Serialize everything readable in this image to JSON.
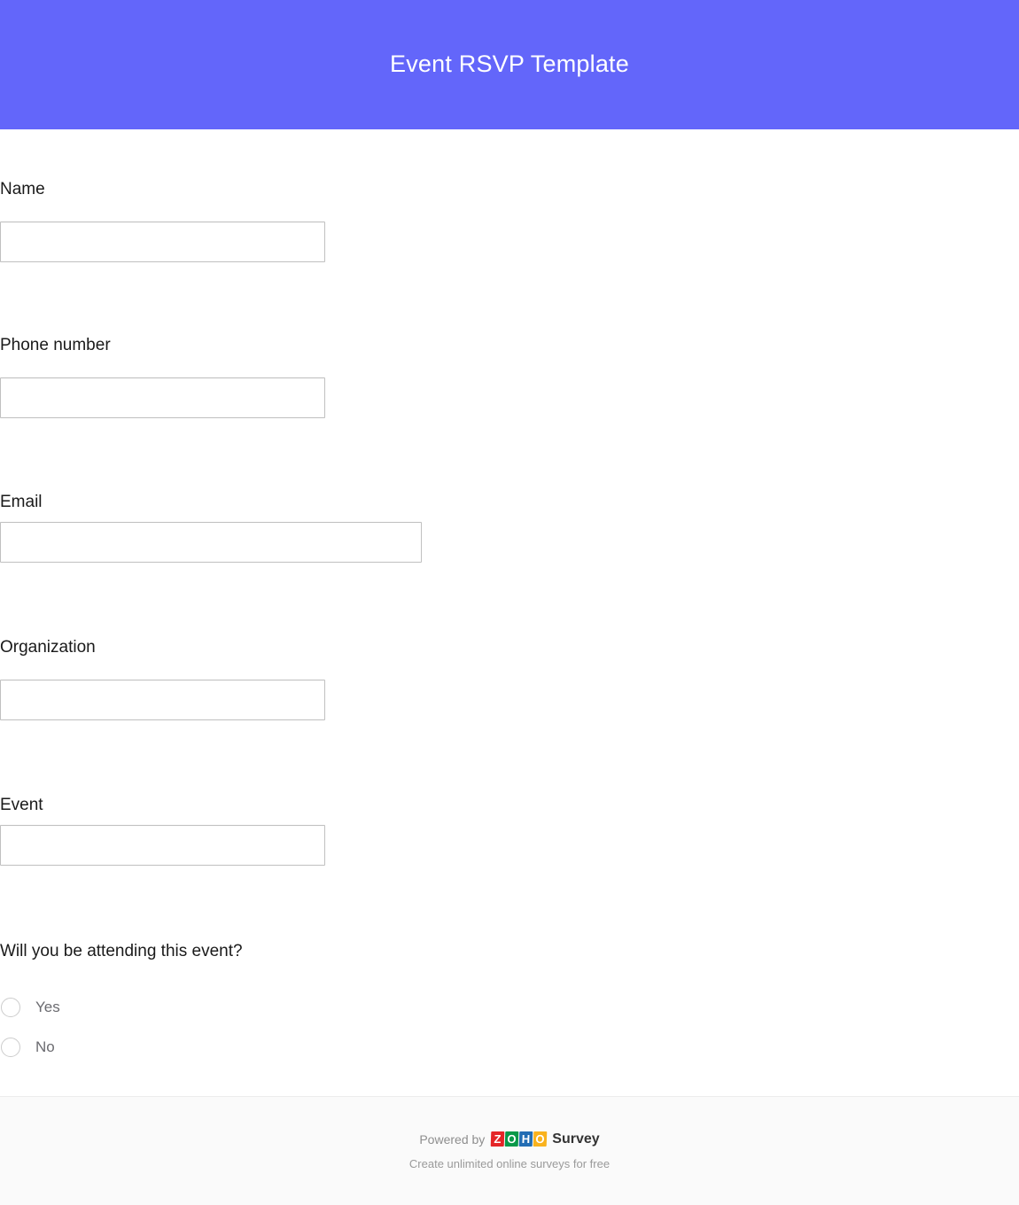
{
  "header": {
    "title": "Event RSVP Template",
    "background_color": "#6366fa",
    "title_color": "#ffffff"
  },
  "form": {
    "fields": [
      {
        "label": "Name",
        "value": "",
        "placeholder": "",
        "type": "text",
        "width": "narrow"
      },
      {
        "label": "Phone number",
        "value": "",
        "placeholder": "",
        "type": "tel",
        "width": "narrow"
      },
      {
        "label": "Email",
        "value": "",
        "placeholder": "",
        "type": "email",
        "width": "wide"
      },
      {
        "label": "Organization",
        "value": "",
        "placeholder": "",
        "type": "text",
        "width": "narrow"
      },
      {
        "label": "Event",
        "value": "",
        "placeholder": "",
        "type": "text",
        "width": "narrow"
      }
    ],
    "attendance_question": {
      "label": "Will you be attending this event?",
      "options": [
        {
          "label": "Yes",
          "selected": false
        },
        {
          "label": "No",
          "selected": false
        }
      ]
    }
  },
  "footer": {
    "powered_by": "Powered by",
    "brand_letters": [
      {
        "char": "Z",
        "color": "#e42527"
      },
      {
        "char": "O",
        "color": "#089949"
      },
      {
        "char": "H",
        "color": "#226db4"
      },
      {
        "char": "O",
        "color": "#f9b21d"
      }
    ],
    "product": "Survey",
    "tagline": "Create unlimited online surveys for free",
    "background_color": "#fafafa"
  }
}
